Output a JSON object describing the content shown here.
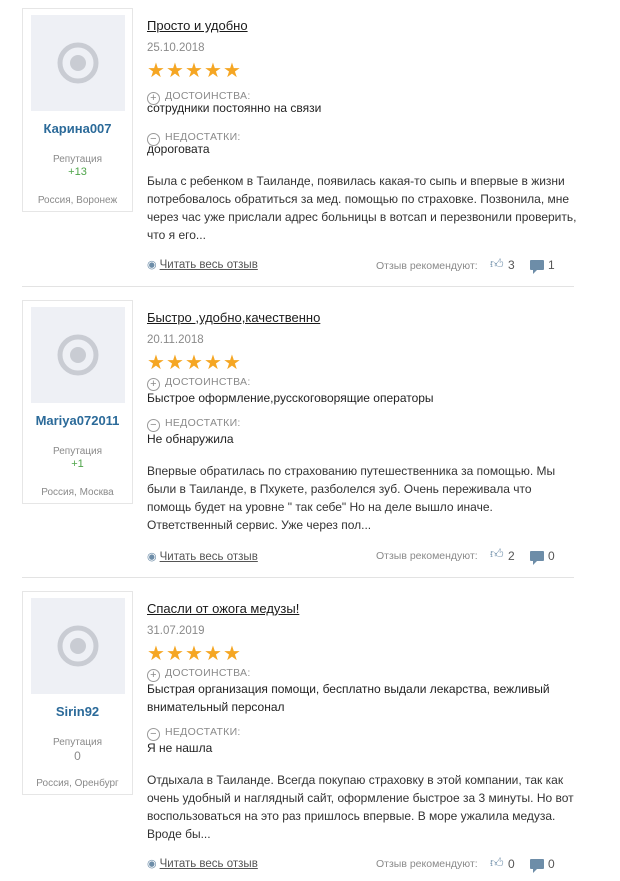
{
  "reviews": [
    {
      "user": {
        "name": "Карина007",
        "reputation_label": "Репутация",
        "reputation": "+13",
        "location": "Россия, Воронеж"
      },
      "title": "Просто и удобно",
      "date": "25.10.2018",
      "rating": 5,
      "pros_label": "ДОСТОИНСТВА:",
      "pros": "сотрудники постоянно на связи",
      "cons_label": "НЕДОСТАТКИ:",
      "cons": "дороговата",
      "text": "Была с ребенком в Таиланде, появилась какая-то сыпь и впервые в жизни потребовалось обратиться за мед. помощью по страховке. Позвонила, мне через час уже прислали адрес больницы в вотсап и перезвонили проверить, что я его...",
      "read_more": "Читать весь отзыв",
      "recommend_label": "Отзыв рекомендуют:",
      "likes": "3",
      "comments": "1"
    },
    {
      "user": {
        "name": "Mariya072011",
        "reputation_label": "Репутация",
        "reputation": "+1",
        "location": "Россия, Москва"
      },
      "title": "Быстро ,удобно,качественно",
      "date": "20.11.2018",
      "rating": 5,
      "pros_label": "ДОСТОИНСТВА:",
      "pros": "Быстрое оформление,русскоговорящие операторы",
      "cons_label": "НЕДОСТАТКИ:",
      "cons": "Не обнаружила",
      "text": "Впервые обратилась по страхованию путешественника за помощью. Мы были в Таиланде, в Пхукете, разболелся зуб. Очень переживала что помощь будет на уровне \" так себе\" Но на деле вышло иначе. Ответственный сервис. Уже через пол...",
      "read_more": "Читать весь отзыв",
      "recommend_label": "Отзыв рекомендуют:",
      "likes": "2",
      "comments": "0"
    },
    {
      "user": {
        "name": "Sirin92",
        "reputation_label": "Репутация",
        "reputation": "0",
        "location": "Россия, Оренбург"
      },
      "title": "Спасли от ожога медузы!",
      "date": "31.07.2019",
      "rating": 5,
      "pros_label": "ДОСТОИНСТВА:",
      "pros": "Быстрая организация помощи, бесплатно выдали лекарства, вежливый внимательный персонал",
      "cons_label": "НЕДОСТАТКИ:",
      "cons": "Я не нашла",
      "text": "Отдыхала в Таиланде. Всегда покупаю страховку в этой компании, так как очень удобный и наглядный сайт, оформление быстрое за 3 минуты. Но вот воспользоваться на это раз пришлось впервые. В море ужалила медуза. Вроде бы...",
      "read_more": "Читать весь отзыв",
      "recommend_label": "Отзыв рекомендуют:",
      "likes": "0",
      "comments": "0"
    }
  ],
  "icons": {
    "plus": "plus-circle-icon",
    "minus": "minus-circle-icon",
    "eye": "eye-icon",
    "like": "thumbs-up-icon",
    "comment": "comment-icon",
    "avatar": "default-avatar-icon",
    "star": "star-icon"
  },
  "colors": {
    "star": "#f5a623",
    "username": "#2b6a99",
    "reputation_positive": "#4ea44a",
    "icon": "#6d8da8"
  }
}
